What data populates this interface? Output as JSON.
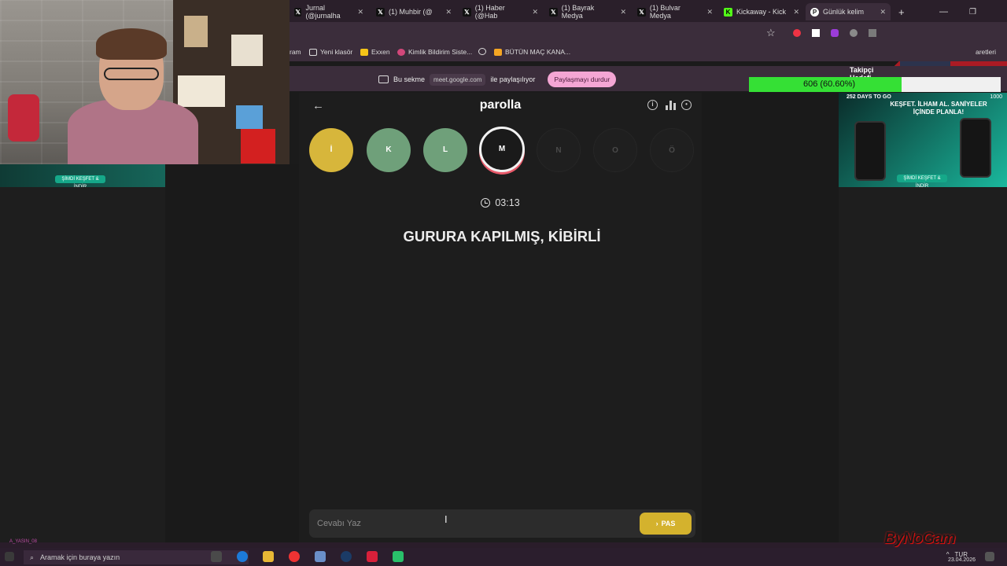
{
  "browser": {
    "tabs": [
      {
        "label": "Jurnal (@jurnalha",
        "icon": "x-logo-icon"
      },
      {
        "label": "(1) Muhbir (@",
        "icon": "x-logo-icon"
      },
      {
        "label": "(1) Haber (@Hab",
        "icon": "x-logo-icon"
      },
      {
        "label": "(1) Bayrak Medya",
        "icon": "x-logo-icon"
      },
      {
        "label": "(1) Bulvar Medya",
        "icon": "x-logo-icon"
      },
      {
        "label": "Kickaway - Kick",
        "icon": "kick-logo-icon"
      },
      {
        "label": "Günlük kelim",
        "icon": "parolla-icon"
      }
    ],
    "bookmarks": [
      {
        "label": "ram"
      },
      {
        "label": "Yeni klasör"
      },
      {
        "label": "Exxen"
      },
      {
        "label": "Kimlik Bildirim Siste..."
      },
      {
        "label": ""
      },
      {
        "label": "BÜTÜN MAÇ KANA..."
      }
    ],
    "bookmarks_right": "aretleri",
    "share": {
      "prefix": "Bu sekme",
      "host": "meet.google.com",
      "suffix": "ile paylaşılıyor",
      "stop_label": "Paylaşmayı durdur"
    }
  },
  "overlay": {
    "goal_title": "Takipçi Hedefi",
    "goal_text": "606 (60.60%)",
    "goal_fraction": 0.606,
    "goal_min": "0",
    "promo_days": "252 DAYS TO GO",
    "promo_max": "1000",
    "promo_headline": "KEŞFET. İLHAM AL. SANİYELER İÇİNDE PLANLA!",
    "promo_cta": "ŞİMDİ KEŞFET & İNDİR",
    "chat_user": "A_YASIN_08",
    "watermark": "ByNoGam",
    "colors": {
      "goal_fill": "#35e035",
      "accent_pink": "#f4a6d4"
    }
  },
  "game": {
    "logo": "parolla",
    "letters": [
      {
        "char": "İ",
        "state": "done-y"
      },
      {
        "char": "K",
        "state": "done-g"
      },
      {
        "char": "L",
        "state": "done-g"
      },
      {
        "char": "M",
        "state": "current"
      },
      {
        "char": "N",
        "state": "pending"
      },
      {
        "char": "O",
        "state": "pending"
      },
      {
        "char": "Ö",
        "state": "pending"
      }
    ],
    "timer": "03:13",
    "question": "GURURA KAPILMIŞ, KİBİRLİ",
    "answer_placeholder": "Cevabı Yaz",
    "answer_value": "",
    "pass_label": "PAS",
    "colors": {
      "yellow": "#d7b63b",
      "green": "#6fa07a",
      "current_ring": "#e85a6a"
    }
  },
  "taskbar": {
    "search_placeholder": "Aramak için buraya yazın",
    "language": "TUR",
    "date": "23.04.2026"
  }
}
